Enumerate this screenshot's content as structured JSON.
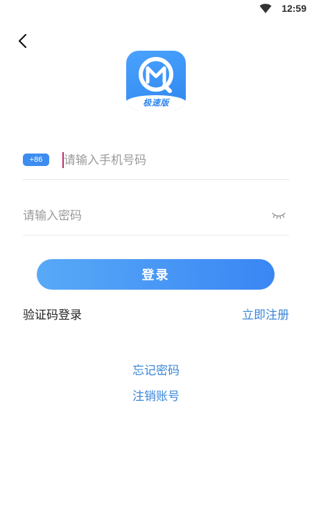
{
  "status_bar": {
    "time": "12:59",
    "icons": [
      "wifi-icon"
    ]
  },
  "header": {
    "back_icon": "chevron-left-icon"
  },
  "logo": {
    "badge_text": "极速版",
    "colors": {
      "primary": "#2f86ee",
      "light": "#4aa3ff"
    }
  },
  "form": {
    "country_code": "+86",
    "phone_placeholder": "请输入手机号码",
    "phone_value": "",
    "password_placeholder": "请输入密码",
    "password_value": "",
    "password_toggle_icon": "eye-closed-icon"
  },
  "actions": {
    "login_label": "登录",
    "sms_login_label": "验证码登录",
    "register_label": "立即注册",
    "forgot_password_label": "忘记密码",
    "cancel_account_label": "注销账号"
  },
  "colors": {
    "accent": "#3a86f4",
    "link": "#3a86d8",
    "cursor": "#c0286d",
    "button_gradient_start": "#58a9f7",
    "button_gradient_end": "#3a86f4"
  }
}
